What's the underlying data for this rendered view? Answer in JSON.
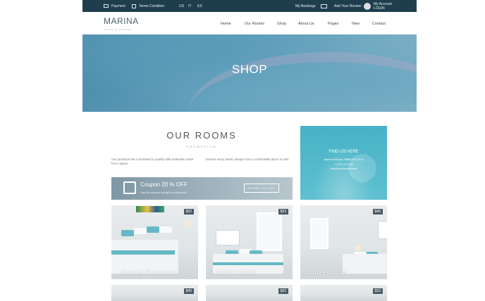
{
  "topbar": {
    "payment": "Payment",
    "terms": "Terms Condition",
    "langs": [
      "US",
      "IT",
      "ES"
    ],
    "bookings": "My Bookings",
    "review": "Add Your Review",
    "account": "My Account",
    "login": "LOGIN"
  },
  "nav": {
    "logo": "MARINA",
    "logo_sub": "HOTEL & RESORT",
    "items": [
      "Home",
      "Our Rooms",
      "Shop",
      "About Us",
      "Pages",
      "New",
      "Contact"
    ]
  },
  "hero": {
    "title": "SHOP"
  },
  "rooms": {
    "title": "OUR ROOMS",
    "subtitle": "- PROMOTION -",
    "para1": "Our products are committed to quality with materials made from nature.",
    "para2": "Ensure every family always has a comfortable place to visit.",
    "coupon": {
      "title": "Coupon 20 % OFF",
      "desc": "Use the coupon during the checkout !",
      "button": "ROOMS SUITES"
    }
  },
  "find_us": {
    "title": "FIND US HERE",
    "address": "Avenue Marina 34568 NY (U.S)",
    "phone": "+1 374 474 637",
    "email": "info@hotelresort.com"
  },
  "cards": [
    {
      "price": "$32",
      "label": "Auttum Promotion"
    },
    {
      "price": "$33",
      "label": "August Offer"
    },
    {
      "price": "$40",
      "label": "Honeymoon"
    },
    {
      "price": "$40",
      "label": ""
    },
    {
      "price": "$20",
      "label": ""
    },
    {
      "price": "$16",
      "label": ""
    }
  ],
  "colors": {
    "topbar": "#1e3e4e",
    "accent": "#47b2c6",
    "price_badge": "#4c5a66"
  }
}
